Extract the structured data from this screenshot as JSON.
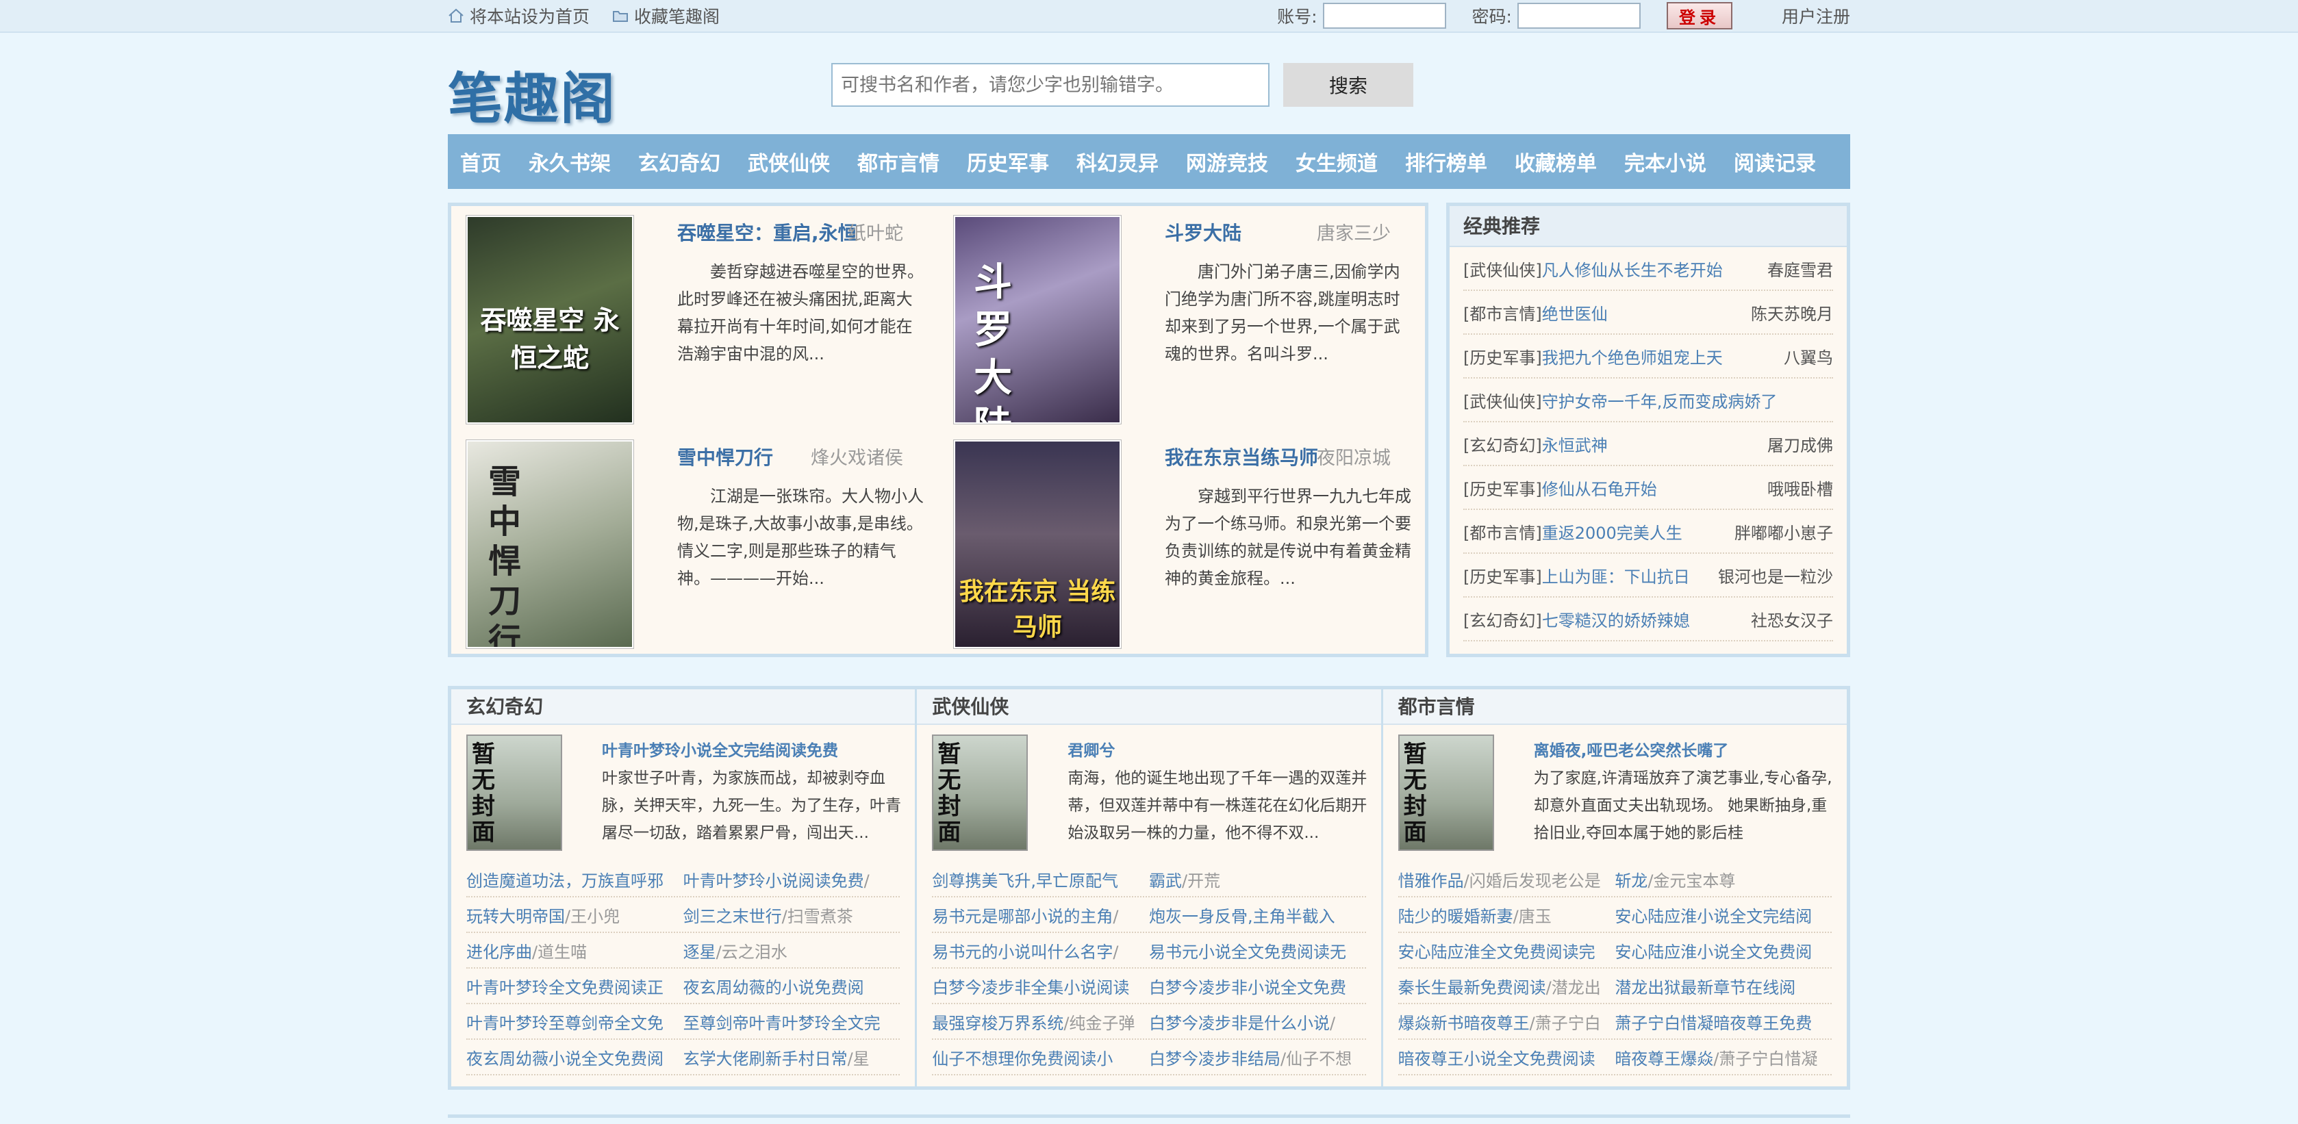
{
  "top": {
    "set_home": "将本站设为首页",
    "bookmark": "收藏笔趣阁",
    "account_label": "账号:",
    "password_label": "密码:",
    "login_button": "登录",
    "register": "用户注册"
  },
  "header": {
    "logo": "笔趣阁",
    "search_placeholder": "可搜书名和作者，请您少字也别输错字。",
    "search_button": "搜索"
  },
  "nav": [
    "首页",
    "永久书架",
    "玄幻奇幻",
    "武侠仙侠",
    "都市言情",
    "历史军事",
    "科幻灵异",
    "网游竞技",
    "女生频道",
    "排行榜单",
    "收藏榜单",
    "完本小说",
    "阅读记录"
  ],
  "featured": [
    {
      "title": "吞噬星空：重启,永恒",
      "author": "纸叶蛇",
      "desc": "姜哲穿越进吞噬星空的世界。此时罗峰还在被头痛困扰,距离大幕拉开尚有十年时间,如何才能在浩瀚宇宙中混的风...",
      "cover": "吞噬星空 永恒之蛇"
    },
    {
      "title": "斗罗大陆",
      "author": "唐家三少",
      "desc": "唐门外门弟子唐三,因偷学内门绝学为唐门所不容,跳崖明志时却来到了另一个世界,一个属于武魂的世界。名叫斗罗...",
      "cover": "斗罗大陆"
    },
    {
      "title": "雪中悍刀行",
      "author": "烽火戏诸侯",
      "desc": "江湖是一张珠帘。大人物小人物,是珠子,大故事小故事,是串线。情义二字,则是那些珠子的精气神。————开始...",
      "cover": "雪中悍刀行"
    },
    {
      "title": "我在东京当练马师",
      "author": "夜阳凉城",
      "desc": "穿越到平行世界一九九七年成为了一个练马师。和泉光第一个要负责训练的就是传说中有着黄金精神的黄金旅程。...",
      "cover": "我在东京 当练马师"
    }
  ],
  "recommend": {
    "title": "经典推荐",
    "items": [
      {
        "cat": "[武侠仙侠]",
        "title": "凡人修仙从长生不老开始",
        "author": "春庭雪君"
      },
      {
        "cat": "[都市言情]",
        "title": "绝世医仙",
        "author": "陈天苏晚月"
      },
      {
        "cat": "[历史军事]",
        "title": "我把九个绝色师姐宠上天",
        "author": "八翼鸟"
      },
      {
        "cat": "[武侠仙侠]",
        "title": "守护女帝一千年,反而变成病娇了",
        "author": ""
      },
      {
        "cat": "[玄幻奇幻]",
        "title": "永恒武神",
        "author": "屠刀成佛"
      },
      {
        "cat": "[历史军事]",
        "title": "修仙从石龟开始",
        "author": "哦哦卧槽"
      },
      {
        "cat": "[都市言情]",
        "title": "重返2000完美人生",
        "author": "胖嘟嘟小崽子"
      },
      {
        "cat": "[历史军事]",
        "title": "上山为匪：下山抗日",
        "author": "银河也是一粒沙"
      },
      {
        "cat": "[玄幻奇幻]",
        "title": "七零糙汉的娇娇辣媳",
        "author": "社恐女汉子"
      }
    ]
  },
  "columns": [
    {
      "title": "玄幻奇幻",
      "no_cover": "暂无封面",
      "book_title": "叶青叶梦玲小说全文完结阅读免费",
      "book_desc": "叶家世子叶青，为家族而战，却被剥夺血脉，关押天牢，九死一生。为了生存，叶青屠尽一切敌，踏着累累尸骨，闯出天...",
      "rows": [
        [
          {
            "n": "创造魔道功法，万族直呼邪",
            "a": ""
          },
          {
            "n": "叶青叶梦玲小说阅读免费",
            "a": "/"
          }
        ],
        [
          {
            "n": "玩转大明帝国",
            "a": "/王小兜"
          },
          {
            "n": "剑三之末世行",
            "a": "/扫雪煮茶"
          }
        ],
        [
          {
            "n": "进化序曲",
            "a": "/道生喵"
          },
          {
            "n": "逐星",
            "a": "/云之泪水"
          }
        ],
        [
          {
            "n": "叶青叶梦玲全文免费阅读正",
            "a": ""
          },
          {
            "n": "夜玄周幼薇的小说免费阅",
            "a": ""
          }
        ],
        [
          {
            "n": "叶青叶梦玲至尊剑帝全文免",
            "a": ""
          },
          {
            "n": "至尊剑帝叶青叶梦玲全文完",
            "a": ""
          }
        ],
        [
          {
            "n": "夜玄周幼薇小说全文免费阅",
            "a": ""
          },
          {
            "n": "玄学大佬刷新手村日常",
            "a": "/星"
          }
        ]
      ]
    },
    {
      "title": "武侠仙侠",
      "no_cover": "暂无封面",
      "book_title": "君卿兮",
      "book_desc": "南海，他的诞生地出现了千年一遇的双莲并蒂，但双莲并蒂中有一株莲花在幻化后期开始汲取另一株的力量，他不得不双...",
      "rows": [
        [
          {
            "n": "剑尊携美飞升,早亡原配气",
            "a": ""
          },
          {
            "n": "霸武",
            "a": "/开荒"
          }
        ],
        [
          {
            "n": "易书元是哪部小说的主角",
            "a": "/"
          },
          {
            "n": "炮灰一身反骨,主角半截入",
            "a": ""
          }
        ],
        [
          {
            "n": "易书元的小说叫什么名字",
            "a": "/"
          },
          {
            "n": "易书元小说全文免费阅读无",
            "a": ""
          }
        ],
        [
          {
            "n": "白梦今凌步非全集小说阅读",
            "a": ""
          },
          {
            "n": "白梦今凌步非小说全文免费",
            "a": ""
          }
        ],
        [
          {
            "n": "最强穿梭万界系统",
            "a": "/纯金子弹"
          },
          {
            "n": "白梦今凌步非是什么小说",
            "a": "/"
          }
        ],
        [
          {
            "n": "仙子不想理你免费阅读小",
            "a": ""
          },
          {
            "n": "白梦今凌步非结局",
            "a": "/仙子不想"
          }
        ]
      ]
    },
    {
      "title": "都市言情",
      "no_cover": "暂无封面",
      "book_title": "离婚夜,哑巴老公突然长嘴了",
      "book_desc": "为了家庭,许清瑶放弃了演艺事业,专心备孕,却意外直面丈夫出轨现场。 她果断抽身,重拾旧业,夺回本属于她的影后桂",
      "rows": [
        [
          {
            "n": "惜雅作品",
            "a": "/闪婚后发现老公是"
          },
          {
            "n": "斩龙",
            "a": "/金元宝本尊"
          }
        ],
        [
          {
            "n": "陆少的暖婚新妻",
            "a": "/唐玉"
          },
          {
            "n": "安心陆应淮小说全文完结阅",
            "a": ""
          }
        ],
        [
          {
            "n": "安心陆应淮全文免费阅读完",
            "a": ""
          },
          {
            "n": "安心陆应淮小说全文免费阅",
            "a": ""
          }
        ],
        [
          {
            "n": "秦长生最新免费阅读",
            "a": "/潜龙出"
          },
          {
            "n": "潜龙出狱最新章节在线阅",
            "a": ""
          }
        ],
        [
          {
            "n": "爆焱新书暗夜尊王",
            "a": "/萧子宁白"
          },
          {
            "n": "萧子宁白惜凝暗夜尊王免费",
            "a": ""
          }
        ],
        [
          {
            "n": "暗夜尊王小说全文免费阅读",
            "a": ""
          },
          {
            "n": "暗夜尊王爆焱",
            "a": "/萧子宁白惜凝"
          }
        ]
      ]
    }
  ]
}
